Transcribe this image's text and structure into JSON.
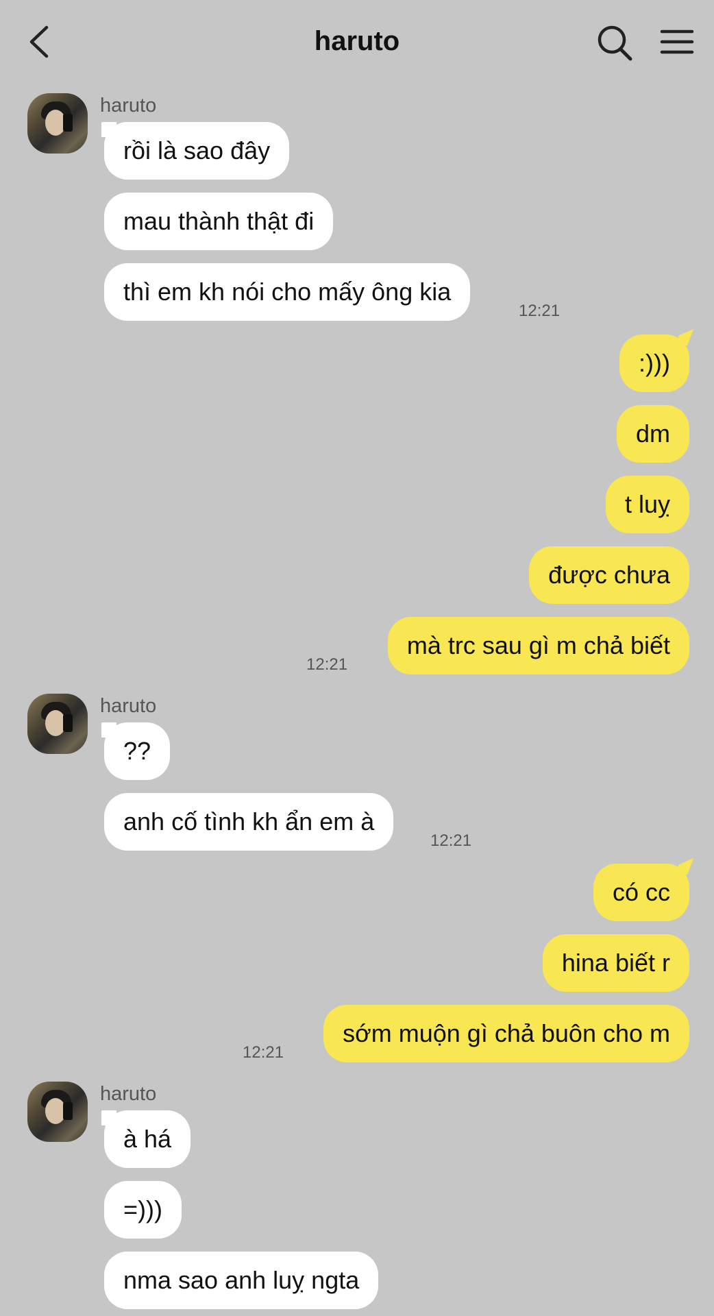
{
  "header": {
    "title": "haruto",
    "icons": [
      "back-icon",
      "search-icon",
      "menu-icon"
    ]
  },
  "contact_name": "haruto",
  "groups": [
    {
      "sender": "haruto",
      "messages": [
        "rồi là sao đây",
        "mau thành thật đi",
        "thì em kh nói cho mấy ông kia"
      ],
      "time": "12:21"
    },
    {
      "sender": "me",
      "messages": [
        ":)))",
        "dm",
        "t luỵ",
        "được chưa",
        "mà trc sau gì m chả biết"
      ],
      "time": "12:21"
    },
    {
      "sender": "haruto",
      "messages": [
        "??",
        "anh cố tình kh ẩn em à"
      ],
      "time": "12:21"
    },
    {
      "sender": "me",
      "messages": [
        "có cc",
        "hina biết r",
        "sớm muộn gì chả buôn cho m"
      ],
      "time": "12:21"
    },
    {
      "sender": "haruto",
      "messages": [
        "à há",
        "=)))",
        "nma sao anh luỵ ngta"
      ]
    }
  ],
  "colors": {
    "background": "#c6c6c6",
    "incoming_bubble": "#ffffff",
    "outgoing_bubble": "#f8e652"
  }
}
